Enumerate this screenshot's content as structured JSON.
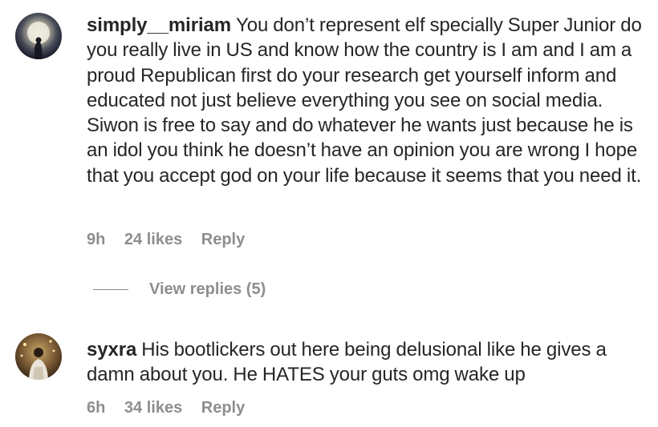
{
  "comments": [
    {
      "username": "simply__miriam",
      "text": "You don’t represent elf specially Super Junior do you really live in US and know how the country is I am and I am a proud Republican first do your research get yourself inform and educated not just believe everything you see on social media. Siwon is free to say and do whatever he wants just because he is an idol you think he doesn’t have an opinion you are wrong I hope that you accept god on your life because it seems that you need it.",
      "time": "9h",
      "likes": "24 likes",
      "reply_label": "Reply"
    },
    {
      "username": "syxra",
      "text": "His bootlickers out here being delusional like he gives a damn about you. He HATES your guts omg wake up",
      "time": "6h",
      "likes": "34 likes",
      "reply_label": "Reply"
    }
  ],
  "view_replies_label": "View replies (5)"
}
